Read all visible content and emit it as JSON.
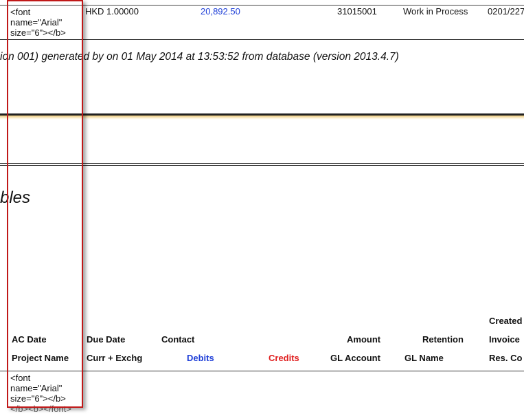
{
  "top_row": {
    "font_snippet": "<font name=\"Arial\" size=\"6\"></b>",
    "currency": "HKD",
    "exchange_rate": "1.00000",
    "amount": "20,892.50",
    "account_code": "31015001",
    "account_name": "Work in Process",
    "project_code": "0201/227"
  },
  "footer": {
    "text": "ion 001) generated by  on 01 May 2014 at 13:53:52 from database  (version 2013.4.7)"
  },
  "section": {
    "title_fragment": "bles"
  },
  "table_header": {
    "created": "Created",
    "ac_date": "AC Date",
    "due_date": "Due Date",
    "contact": "Contact",
    "amount": "Amount",
    "retention": "Retention",
    "invoice": "Invoice",
    "project_name": "Project Name",
    "curr_exchg": "Curr + Exchg",
    "debits": "Debits",
    "credits": "Credits",
    "gl_account": "GL Account",
    "gl_name": "GL Name",
    "res_co": "Res. Co"
  },
  "bottom_row": {
    "font_snippet": "<font name=\"Arial\" size=\"6\"></b>",
    "cutoff_text": "</b><b></font>"
  },
  "colors": {
    "debits": "#2040d8",
    "credits": "#e02020",
    "highlight": "#c01818"
  }
}
